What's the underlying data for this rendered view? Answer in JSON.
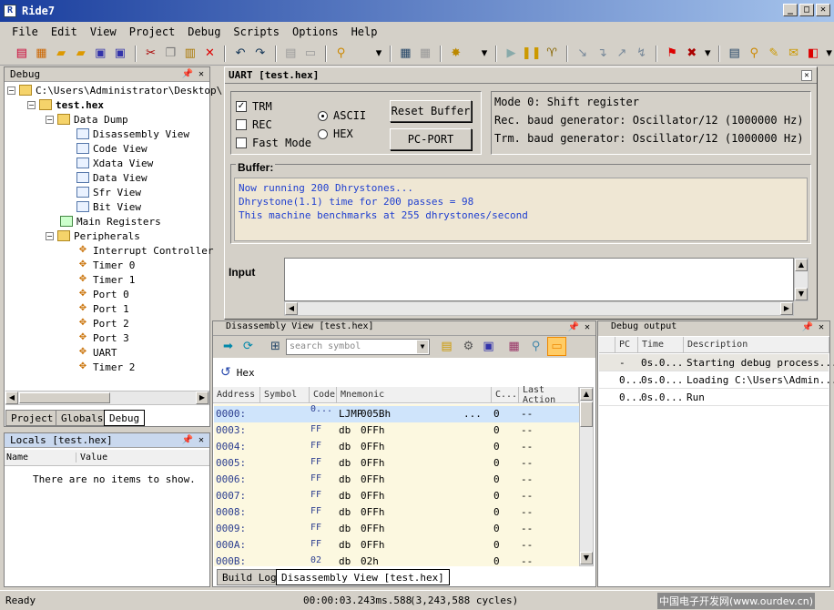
{
  "window": {
    "title": "Ride7",
    "btn_min": "_",
    "btn_max": "□",
    "btn_close": "✕"
  },
  "menu": [
    "File",
    "Edit",
    "View",
    "Project",
    "Debug",
    "Scripts",
    "Options",
    "Help"
  ],
  "debug_panel": {
    "title": "Debug",
    "tree": {
      "root": "C:\\Users\\Administrator\\Desktop\\",
      "file": "test.hex",
      "data_dump": "Data Dump",
      "views": [
        "Disassembly View",
        "Code View",
        "Xdata View",
        "Data View",
        "Sfr View",
        "Bit View"
      ],
      "main_registers": "Main Registers",
      "peripherals": "Peripherals",
      "peripheral_items": [
        "Interrupt Controller",
        "Timer 0",
        "Timer 1",
        "Port 0",
        "Port 1",
        "Port 2",
        "Port 3",
        "UART",
        "Timer 2"
      ]
    },
    "tabs": [
      "Project",
      "Globals",
      "Debug"
    ],
    "active_tab": "Debug"
  },
  "locals": {
    "title": "Locals [test.hex]",
    "col_name": "Name",
    "col_value": "Value",
    "empty": "There are no items to show."
  },
  "uart": {
    "title": "UART [test.hex]",
    "close": "✕",
    "trm": "TRM",
    "rec": "REC",
    "fast_mode": "Fast Mode",
    "ascii": "ASCII",
    "hex": "HEX",
    "reset_buffer": "Reset Buffer",
    "pc_port": "PC-PORT",
    "mode": "Mode 0: Shift register",
    "rec_baud": "Rec. baud generator: Oscillator/12 (1000000 Hz)",
    "trm_baud": "Trm. baud generator: Oscillator/12 (1000000 Hz)",
    "buffer_label": "Buffer:",
    "buffer_lines": [
      "Now running 200 Dhrystones...",
      "Dhrystone(1.1) time for 200 passes = 98",
      "This machine benchmarks at 255 dhrystones/second"
    ],
    "input_label": "Input",
    "input_value": ""
  },
  "disassembly": {
    "title": "Disassembly View [test.hex]",
    "search_placeholder": "search symbol",
    "hex_label": "Hex",
    "columns": [
      "Address",
      "Symbol",
      "Code",
      "Mnemonic",
      "C...",
      "Last Action"
    ],
    "rows": [
      {
        "addr": "0000:",
        "sym": "",
        "code": "0...",
        "mn": "LJMP",
        "op": "005Bh",
        "extra": "...",
        "c": "0",
        "last": "--"
      },
      {
        "addr": "0003:",
        "sym": "",
        "code": "FF",
        "mn": "db",
        "op": "0FFh",
        "extra": "",
        "c": "0",
        "last": "--"
      },
      {
        "addr": "0004:",
        "sym": "",
        "code": "FF",
        "mn": "db",
        "op": "0FFh",
        "extra": "",
        "c": "0",
        "last": "--"
      },
      {
        "addr": "0005:",
        "sym": "",
        "code": "FF",
        "mn": "db",
        "op": "0FFh",
        "extra": "",
        "c": "0",
        "last": "--"
      },
      {
        "addr": "0006:",
        "sym": "",
        "code": "FF",
        "mn": "db",
        "op": "0FFh",
        "extra": "",
        "c": "0",
        "last": "--"
      },
      {
        "addr": "0007:",
        "sym": "",
        "code": "FF",
        "mn": "db",
        "op": "0FFh",
        "extra": "",
        "c": "0",
        "last": "--"
      },
      {
        "addr": "0008:",
        "sym": "",
        "code": "FF",
        "mn": "db",
        "op": "0FFh",
        "extra": "",
        "c": "0",
        "last": "--"
      },
      {
        "addr": "0009:",
        "sym": "",
        "code": "FF",
        "mn": "db",
        "op": "0FFh",
        "extra": "",
        "c": "0",
        "last": "--"
      },
      {
        "addr": "000A:",
        "sym": "",
        "code": "FF",
        "mn": "db",
        "op": "0FFh",
        "extra": "",
        "c": "0",
        "last": "--"
      },
      {
        "addr": "000B:",
        "sym": "",
        "code": "02",
        "mn": "db",
        "op": "02h",
        "extra": "",
        "c": "0",
        "last": "--"
      }
    ],
    "tabs": [
      "Build Log",
      "Disassembly View [test.hex]"
    ],
    "active_tab": "Disassembly View [test.hex]"
  },
  "debug_output": {
    "title": "Debug output",
    "columns": [
      "PC",
      "Time",
      "Description"
    ],
    "rows": [
      {
        "pc": "-",
        "time": "0s.0...",
        "desc": "Starting debug process..."
      },
      {
        "pc": "0...",
        "time": "0s.0...",
        "desc": "Loading C:\\Users\\Admin..."
      },
      {
        "pc": "0...",
        "time": "0s.0...",
        "desc": "Run"
      }
    ]
  },
  "status": {
    "left": "Ready",
    "time": "00:00:03.243ms.588",
    "cycles": "(3,243,588 cycles)",
    "watermark": "中国电子开发网(www.ourdev.cn)"
  },
  "colors": {
    "title_start": "#1a3e9e",
    "title_end": "#a6c4ec",
    "buffer_bg": "#efe7d4",
    "buffer_text": "#1f3fd0",
    "selected_row": "#cfe4fb",
    "code_bg": "#fcf8e0"
  }
}
